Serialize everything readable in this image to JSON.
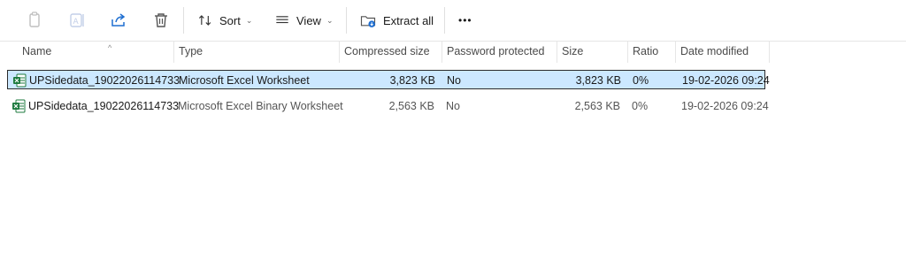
{
  "toolbar": {
    "copy_icon": "copy-icon",
    "rename_icon": "rename-icon",
    "share_icon": "share-icon",
    "delete_icon": "delete-icon",
    "sort_label": "Sort",
    "view_label": "View",
    "extract_label": "Extract all",
    "more_label": "•••"
  },
  "columns": {
    "name": "Name",
    "type": "Type",
    "compressed_size": "Compressed size",
    "password_protected": "Password protected",
    "size": "Size",
    "ratio": "Ratio",
    "date_modified": "Date modified"
  },
  "files": [
    {
      "name": "UPSidedata_19022026114733",
      "type": "Microsoft Excel Worksheet",
      "compressed_size": "3,823 KB",
      "password_protected": "No",
      "size": "3,823 KB",
      "ratio": "0%",
      "date_modified": "19-02-2026 09:24",
      "selected": true
    },
    {
      "name": "UPSidedata_19022026114733",
      "type": "Microsoft Excel Binary Worksheet",
      "compressed_size": "2,563 KB",
      "password_protected": "No",
      "size": "2,563 KB",
      "ratio": "0%",
      "date_modified": "19-02-2026 09:24",
      "selected": false
    }
  ],
  "colors": {
    "selection_bg": "#cce8ff",
    "excel_green": "#1d7a3e",
    "accent_blue": "#1f6fd1"
  }
}
